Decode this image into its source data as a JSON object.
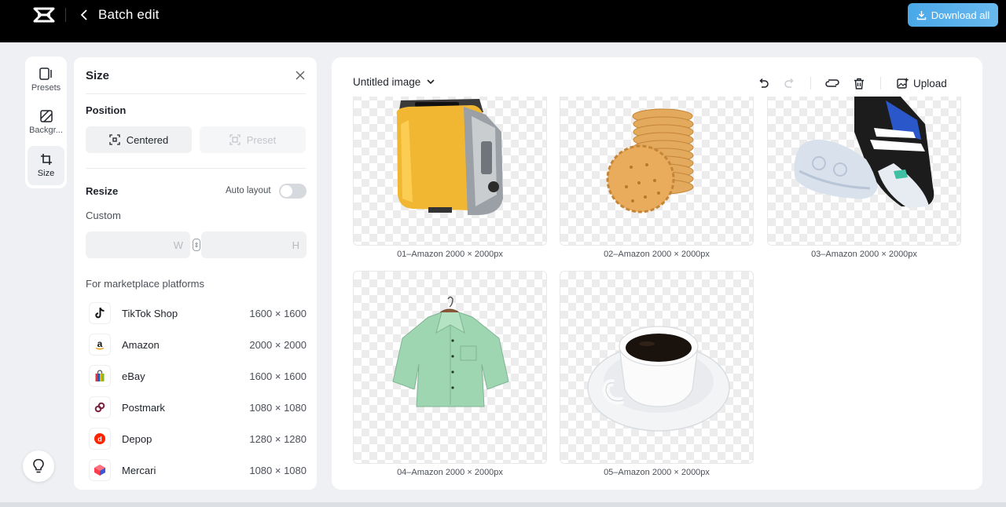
{
  "header": {
    "logo": "capcut-logo-icon",
    "back_icon": "chevron-left-icon",
    "title": "Batch edit",
    "download_label": "Download all"
  },
  "rail": {
    "items": [
      {
        "label": "Presets",
        "icon": "presets-icon"
      },
      {
        "label": "Backgr...",
        "icon": "background-icon"
      },
      {
        "label": "Size",
        "icon": "crop-icon",
        "active": true
      }
    ]
  },
  "panel": {
    "title": "Size",
    "position_label": "Position",
    "centered_label": "Centered",
    "preset_label": "Preset",
    "resize_label": "Resize",
    "auto_layout_label": "Auto layout",
    "auto_layout_on": false,
    "custom_label": "Custom",
    "width_placeholder": "W",
    "height_placeholder": "H",
    "marketplace_label": "For marketplace platforms",
    "platforms": [
      {
        "name": "TikTok Shop",
        "size": "1600 × 1600",
        "icon": "tiktok-icon"
      },
      {
        "name": "Amazon",
        "size": "2000 × 2000",
        "icon": "amazon-icon"
      },
      {
        "name": "eBay",
        "size": "1600 × 1600",
        "icon": "ebay-bag-icon"
      },
      {
        "name": "Postmark",
        "size": "1080 × 1080",
        "icon": "postmark-icon"
      },
      {
        "name": "Depop",
        "size": "1280 × 1280",
        "icon": "depop-icon"
      },
      {
        "name": "Mercari",
        "size": "1080 × 1080",
        "icon": "mercari-icon"
      }
    ]
  },
  "canvas": {
    "doc_title": "Untitled image",
    "upload_label": "Upload",
    "images": [
      {
        "caption": "01–Amazon 2000 × 2000px",
        "subject": "toaster"
      },
      {
        "caption": "02–Amazon 2000 × 2000px",
        "subject": "biscuits"
      },
      {
        "caption": "03–Amazon 2000 × 2000px",
        "subject": "sneakers"
      },
      {
        "caption": "04–Amazon 2000 × 2000px",
        "subject": "shirt"
      },
      {
        "caption": "05–Amazon 2000 × 2000px",
        "subject": "coffee-cup"
      }
    ]
  },
  "colors": {
    "accent": "#4aa8e8",
    "topbar": "#000000"
  }
}
